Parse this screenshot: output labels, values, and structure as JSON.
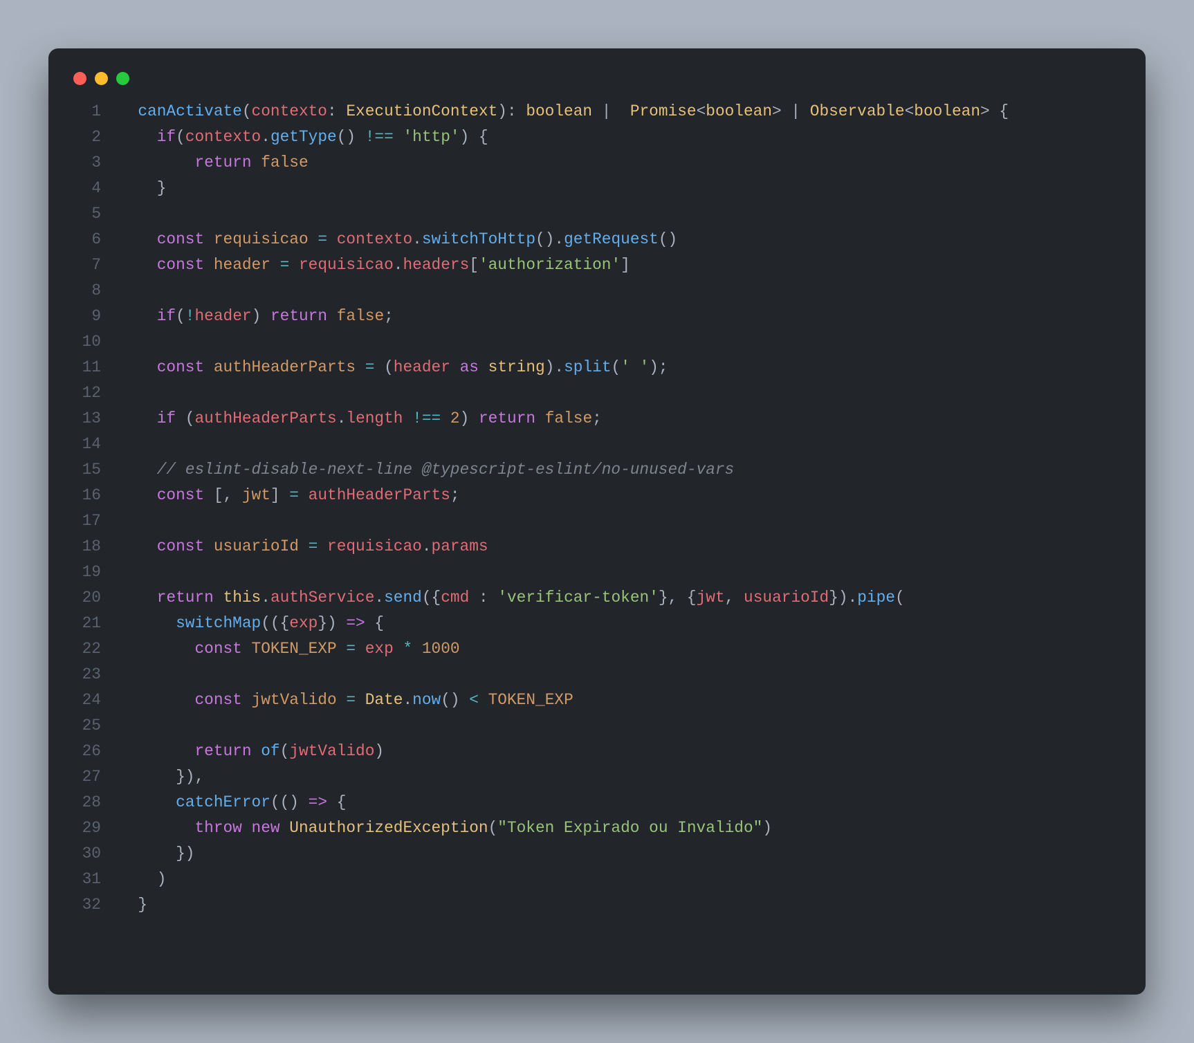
{
  "lines": [
    {
      "n": "1",
      "tokens": [
        {
          "c": "tok-default",
          "t": "  "
        },
        {
          "c": "tok-fn",
          "t": "canActivate"
        },
        {
          "c": "tok-default",
          "t": "("
        },
        {
          "c": "tok-param",
          "t": "contexto"
        },
        {
          "c": "tok-default",
          "t": ": "
        },
        {
          "c": "tok-type",
          "t": "ExecutionContext"
        },
        {
          "c": "tok-default",
          "t": "): "
        },
        {
          "c": "tok-type",
          "t": "boolean"
        },
        {
          "c": "tok-default",
          "t": " |  "
        },
        {
          "c": "tok-type",
          "t": "Promise"
        },
        {
          "c": "tok-default",
          "t": "<"
        },
        {
          "c": "tok-type",
          "t": "boolean"
        },
        {
          "c": "tok-default",
          "t": "> | "
        },
        {
          "c": "tok-type",
          "t": "Observable"
        },
        {
          "c": "tok-default",
          "t": "<"
        },
        {
          "c": "tok-type",
          "t": "boolean"
        },
        {
          "c": "tok-default",
          "t": "> {"
        }
      ]
    },
    {
      "n": "2",
      "tokens": [
        {
          "c": "tok-default",
          "t": "    "
        },
        {
          "c": "tok-kw",
          "t": "if"
        },
        {
          "c": "tok-default",
          "t": "("
        },
        {
          "c": "tok-prop",
          "t": "contexto"
        },
        {
          "c": "tok-default",
          "t": "."
        },
        {
          "c": "tok-fn",
          "t": "getType"
        },
        {
          "c": "tok-default",
          "t": "() "
        },
        {
          "c": "tok-op",
          "t": "!=="
        },
        {
          "c": "tok-default",
          "t": " "
        },
        {
          "c": "tok-str",
          "t": "'http'"
        },
        {
          "c": "tok-default",
          "t": ") {"
        }
      ]
    },
    {
      "n": "3",
      "tokens": [
        {
          "c": "tok-default",
          "t": "        "
        },
        {
          "c": "tok-kw",
          "t": "return"
        },
        {
          "c": "tok-default",
          "t": " "
        },
        {
          "c": "tok-bool",
          "t": "false"
        }
      ]
    },
    {
      "n": "4",
      "tokens": [
        {
          "c": "tok-default",
          "t": "    }"
        }
      ]
    },
    {
      "n": "5",
      "tokens": [
        {
          "c": "tok-default",
          "t": ""
        }
      ]
    },
    {
      "n": "6",
      "tokens": [
        {
          "c": "tok-default",
          "t": "    "
        },
        {
          "c": "tok-kw",
          "t": "const"
        },
        {
          "c": "tok-default",
          "t": " "
        },
        {
          "c": "tok-const",
          "t": "requisicao"
        },
        {
          "c": "tok-default",
          "t": " "
        },
        {
          "c": "tok-op",
          "t": "="
        },
        {
          "c": "tok-default",
          "t": " "
        },
        {
          "c": "tok-prop",
          "t": "contexto"
        },
        {
          "c": "tok-default",
          "t": "."
        },
        {
          "c": "tok-fn",
          "t": "switchToHttp"
        },
        {
          "c": "tok-default",
          "t": "()."
        },
        {
          "c": "tok-fn",
          "t": "getRequest"
        },
        {
          "c": "tok-default",
          "t": "()"
        }
      ]
    },
    {
      "n": "7",
      "tokens": [
        {
          "c": "tok-default",
          "t": "    "
        },
        {
          "c": "tok-kw",
          "t": "const"
        },
        {
          "c": "tok-default",
          "t": " "
        },
        {
          "c": "tok-const",
          "t": "header"
        },
        {
          "c": "tok-default",
          "t": " "
        },
        {
          "c": "tok-op",
          "t": "="
        },
        {
          "c": "tok-default",
          "t": " "
        },
        {
          "c": "tok-prop",
          "t": "requisicao"
        },
        {
          "c": "tok-default",
          "t": "."
        },
        {
          "c": "tok-prop",
          "t": "headers"
        },
        {
          "c": "tok-default",
          "t": "["
        },
        {
          "c": "tok-str",
          "t": "'authorization'"
        },
        {
          "c": "tok-default",
          "t": "]"
        }
      ]
    },
    {
      "n": "8",
      "tokens": [
        {
          "c": "tok-default",
          "t": ""
        }
      ]
    },
    {
      "n": "9",
      "tokens": [
        {
          "c": "tok-default",
          "t": "    "
        },
        {
          "c": "tok-kw",
          "t": "if"
        },
        {
          "c": "tok-default",
          "t": "("
        },
        {
          "c": "tok-op",
          "t": "!"
        },
        {
          "c": "tok-prop",
          "t": "header"
        },
        {
          "c": "tok-default",
          "t": ") "
        },
        {
          "c": "tok-kw",
          "t": "return"
        },
        {
          "c": "tok-default",
          "t": " "
        },
        {
          "c": "tok-bool",
          "t": "false"
        },
        {
          "c": "tok-default",
          "t": ";"
        }
      ]
    },
    {
      "n": "10",
      "tokens": [
        {
          "c": "tok-default",
          "t": ""
        }
      ]
    },
    {
      "n": "11",
      "tokens": [
        {
          "c": "tok-default",
          "t": "    "
        },
        {
          "c": "tok-kw",
          "t": "const"
        },
        {
          "c": "tok-default",
          "t": " "
        },
        {
          "c": "tok-const",
          "t": "authHeaderParts"
        },
        {
          "c": "tok-default",
          "t": " "
        },
        {
          "c": "tok-op",
          "t": "="
        },
        {
          "c": "tok-default",
          "t": " ("
        },
        {
          "c": "tok-prop",
          "t": "header"
        },
        {
          "c": "tok-default",
          "t": " "
        },
        {
          "c": "tok-kw",
          "t": "as"
        },
        {
          "c": "tok-default",
          "t": " "
        },
        {
          "c": "tok-type",
          "t": "string"
        },
        {
          "c": "tok-default",
          "t": ")."
        },
        {
          "c": "tok-fn",
          "t": "split"
        },
        {
          "c": "tok-default",
          "t": "("
        },
        {
          "c": "tok-str",
          "t": "' '"
        },
        {
          "c": "tok-default",
          "t": ");"
        }
      ]
    },
    {
      "n": "12",
      "tokens": [
        {
          "c": "tok-default",
          "t": ""
        }
      ]
    },
    {
      "n": "13",
      "tokens": [
        {
          "c": "tok-default",
          "t": "    "
        },
        {
          "c": "tok-kw",
          "t": "if"
        },
        {
          "c": "tok-default",
          "t": " ("
        },
        {
          "c": "tok-prop",
          "t": "authHeaderParts"
        },
        {
          "c": "tok-default",
          "t": "."
        },
        {
          "c": "tok-prop",
          "t": "length"
        },
        {
          "c": "tok-default",
          "t": " "
        },
        {
          "c": "tok-op",
          "t": "!=="
        },
        {
          "c": "tok-default",
          "t": " "
        },
        {
          "c": "tok-num",
          "t": "2"
        },
        {
          "c": "tok-default",
          "t": ") "
        },
        {
          "c": "tok-kw",
          "t": "return"
        },
        {
          "c": "tok-default",
          "t": " "
        },
        {
          "c": "tok-bool",
          "t": "false"
        },
        {
          "c": "tok-default",
          "t": ";"
        }
      ]
    },
    {
      "n": "14",
      "tokens": [
        {
          "c": "tok-default",
          "t": ""
        }
      ]
    },
    {
      "n": "15",
      "tokens": [
        {
          "c": "tok-default",
          "t": "    "
        },
        {
          "c": "tok-comment",
          "t": "// eslint-disable-next-line @typescript-eslint/no-unused-vars"
        }
      ]
    },
    {
      "n": "16",
      "tokens": [
        {
          "c": "tok-default",
          "t": "    "
        },
        {
          "c": "tok-kw",
          "t": "const"
        },
        {
          "c": "tok-default",
          "t": " [, "
        },
        {
          "c": "tok-const",
          "t": "jwt"
        },
        {
          "c": "tok-default",
          "t": "] "
        },
        {
          "c": "tok-op",
          "t": "="
        },
        {
          "c": "tok-default",
          "t": " "
        },
        {
          "c": "tok-prop",
          "t": "authHeaderParts"
        },
        {
          "c": "tok-default",
          "t": ";"
        }
      ]
    },
    {
      "n": "17",
      "tokens": [
        {
          "c": "tok-default",
          "t": ""
        }
      ]
    },
    {
      "n": "18",
      "tokens": [
        {
          "c": "tok-default",
          "t": "    "
        },
        {
          "c": "tok-kw",
          "t": "const"
        },
        {
          "c": "tok-default",
          "t": " "
        },
        {
          "c": "tok-const",
          "t": "usuarioId"
        },
        {
          "c": "tok-default",
          "t": " "
        },
        {
          "c": "tok-op",
          "t": "="
        },
        {
          "c": "tok-default",
          "t": " "
        },
        {
          "c": "tok-prop",
          "t": "requisicao"
        },
        {
          "c": "tok-default",
          "t": "."
        },
        {
          "c": "tok-prop",
          "t": "params"
        }
      ]
    },
    {
      "n": "19",
      "tokens": [
        {
          "c": "tok-default",
          "t": ""
        }
      ]
    },
    {
      "n": "20",
      "tokens": [
        {
          "c": "tok-default",
          "t": "    "
        },
        {
          "c": "tok-kw",
          "t": "return"
        },
        {
          "c": "tok-default",
          "t": " "
        },
        {
          "c": "tok-this",
          "t": "this"
        },
        {
          "c": "tok-default",
          "t": "."
        },
        {
          "c": "tok-prop",
          "t": "authService"
        },
        {
          "c": "tok-default",
          "t": "."
        },
        {
          "c": "tok-fn",
          "t": "send"
        },
        {
          "c": "tok-default",
          "t": "({"
        },
        {
          "c": "tok-prop",
          "t": "cmd"
        },
        {
          "c": "tok-default",
          "t": " : "
        },
        {
          "c": "tok-str",
          "t": "'verificar-token'"
        },
        {
          "c": "tok-default",
          "t": "}, {"
        },
        {
          "c": "tok-prop",
          "t": "jwt"
        },
        {
          "c": "tok-default",
          "t": ", "
        },
        {
          "c": "tok-prop",
          "t": "usuarioId"
        },
        {
          "c": "tok-default",
          "t": "})."
        },
        {
          "c": "tok-fn",
          "t": "pipe"
        },
        {
          "c": "tok-default",
          "t": "("
        }
      ]
    },
    {
      "n": "21",
      "tokens": [
        {
          "c": "tok-default",
          "t": "      "
        },
        {
          "c": "tok-fn",
          "t": "switchMap"
        },
        {
          "c": "tok-default",
          "t": "(({"
        },
        {
          "c": "tok-prop",
          "t": "exp"
        },
        {
          "c": "tok-default",
          "t": "}) "
        },
        {
          "c": "tok-kw",
          "t": "=>"
        },
        {
          "c": "tok-default",
          "t": " {"
        }
      ]
    },
    {
      "n": "22",
      "tokens": [
        {
          "c": "tok-default",
          "t": "        "
        },
        {
          "c": "tok-kw",
          "t": "const"
        },
        {
          "c": "tok-default",
          "t": " "
        },
        {
          "c": "tok-const",
          "t": "TOKEN_EXP"
        },
        {
          "c": "tok-default",
          "t": " "
        },
        {
          "c": "tok-op",
          "t": "="
        },
        {
          "c": "tok-default",
          "t": " "
        },
        {
          "c": "tok-prop",
          "t": "exp"
        },
        {
          "c": "tok-default",
          "t": " "
        },
        {
          "c": "tok-op",
          "t": "*"
        },
        {
          "c": "tok-default",
          "t": " "
        },
        {
          "c": "tok-num",
          "t": "1000"
        }
      ]
    },
    {
      "n": "23",
      "tokens": [
        {
          "c": "tok-default",
          "t": ""
        }
      ]
    },
    {
      "n": "24",
      "tokens": [
        {
          "c": "tok-default",
          "t": "        "
        },
        {
          "c": "tok-kw",
          "t": "const"
        },
        {
          "c": "tok-default",
          "t": " "
        },
        {
          "c": "tok-const",
          "t": "jwtValido"
        },
        {
          "c": "tok-default",
          "t": " "
        },
        {
          "c": "tok-op",
          "t": "="
        },
        {
          "c": "tok-default",
          "t": " "
        },
        {
          "c": "tok-type",
          "t": "Date"
        },
        {
          "c": "tok-default",
          "t": "."
        },
        {
          "c": "tok-fn",
          "t": "now"
        },
        {
          "c": "tok-default",
          "t": "() "
        },
        {
          "c": "tok-op",
          "t": "<"
        },
        {
          "c": "tok-default",
          "t": " "
        },
        {
          "c": "tok-const",
          "t": "TOKEN_EXP"
        }
      ]
    },
    {
      "n": "25",
      "tokens": [
        {
          "c": "tok-default",
          "t": ""
        }
      ]
    },
    {
      "n": "26",
      "tokens": [
        {
          "c": "tok-default",
          "t": "        "
        },
        {
          "c": "tok-kw",
          "t": "return"
        },
        {
          "c": "tok-default",
          "t": " "
        },
        {
          "c": "tok-fn",
          "t": "of"
        },
        {
          "c": "tok-default",
          "t": "("
        },
        {
          "c": "tok-prop",
          "t": "jwtValido"
        },
        {
          "c": "tok-default",
          "t": ")"
        }
      ]
    },
    {
      "n": "27",
      "tokens": [
        {
          "c": "tok-default",
          "t": "      }),"
        }
      ]
    },
    {
      "n": "28",
      "tokens": [
        {
          "c": "tok-default",
          "t": "      "
        },
        {
          "c": "tok-fn",
          "t": "catchError"
        },
        {
          "c": "tok-default",
          "t": "(() "
        },
        {
          "c": "tok-kw",
          "t": "=>"
        },
        {
          "c": "tok-default",
          "t": " {"
        }
      ]
    },
    {
      "n": "29",
      "tokens": [
        {
          "c": "tok-default",
          "t": "        "
        },
        {
          "c": "tok-kw",
          "t": "throw"
        },
        {
          "c": "tok-default",
          "t": " "
        },
        {
          "c": "tok-kw",
          "t": "new"
        },
        {
          "c": "tok-default",
          "t": " "
        },
        {
          "c": "tok-type",
          "t": "UnauthorizedException"
        },
        {
          "c": "tok-default",
          "t": "("
        },
        {
          "c": "tok-str",
          "t": "\"Token Expirado ou Invalido\""
        },
        {
          "c": "tok-default",
          "t": ")"
        }
      ]
    },
    {
      "n": "30",
      "tokens": [
        {
          "c": "tok-default",
          "t": "      })"
        }
      ]
    },
    {
      "n": "31",
      "tokens": [
        {
          "c": "tok-default",
          "t": "    )"
        }
      ]
    },
    {
      "n": "32",
      "tokens": [
        {
          "c": "tok-default",
          "t": "  }"
        }
      ]
    }
  ]
}
